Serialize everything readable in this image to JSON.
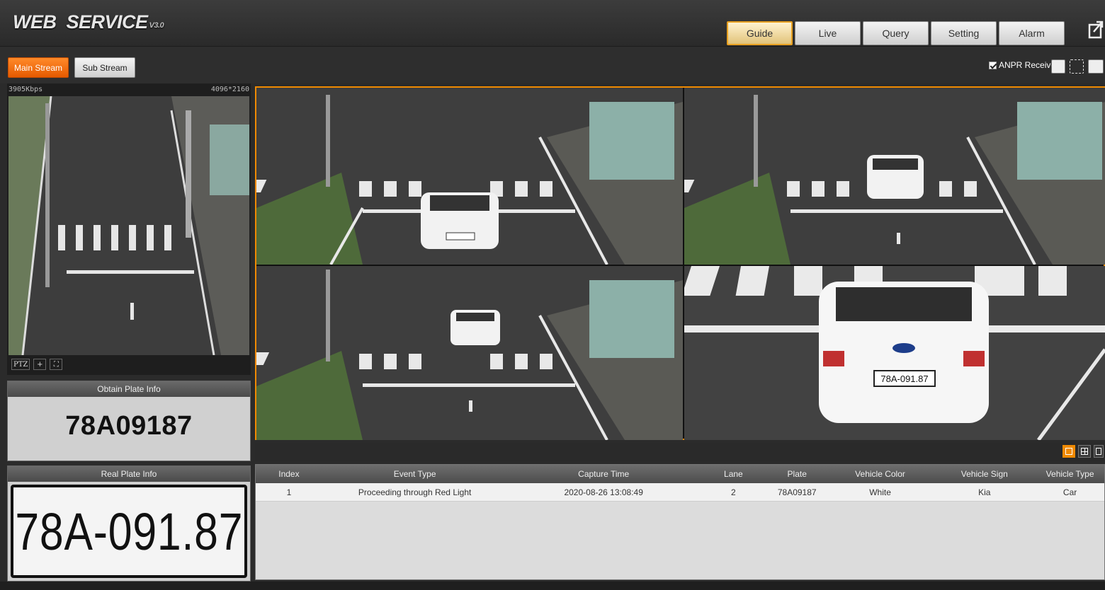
{
  "header": {
    "logo": "WEB  SERVICE",
    "version": "V3.0",
    "tabs": [
      {
        "label": "Guide",
        "active": true
      },
      {
        "label": "Live",
        "active": false
      },
      {
        "label": "Query",
        "active": false
      },
      {
        "label": "Setting",
        "active": false
      },
      {
        "label": "Alarm",
        "active": false
      }
    ]
  },
  "stream": {
    "main_label": "Main Stream",
    "sub_label": "Sub Stream",
    "anpr_label": "ANPR Receive",
    "anpr_checked": true
  },
  "camera": {
    "bitrate": "3905Kbps",
    "resolution": "4096*2160",
    "tools": [
      "PTZ"
    ]
  },
  "obtain_plate": {
    "title": "Obtain Plate Info",
    "plate": "78A09187"
  },
  "real_plate": {
    "title": "Real Plate Info",
    "plate": "78A-091.87"
  },
  "capture_views": {
    "small_plate": "78A-091.87",
    "large_plate": "78A-091.87"
  },
  "table": {
    "headers": [
      "Index",
      "Event Type",
      "Capture Time",
      "Lane",
      "Plate",
      "Vehicle Color",
      "Vehicle Sign",
      "Vehicle Type"
    ],
    "rows": [
      [
        "1",
        "Proceeding through Red Light",
        "2020-08-26 13:08:49",
        "2",
        "78A09187",
        "White",
        "Kia",
        "Car"
      ]
    ]
  },
  "colors": {
    "accent": "#f08a00",
    "header_bg": "#2b2b2b"
  }
}
